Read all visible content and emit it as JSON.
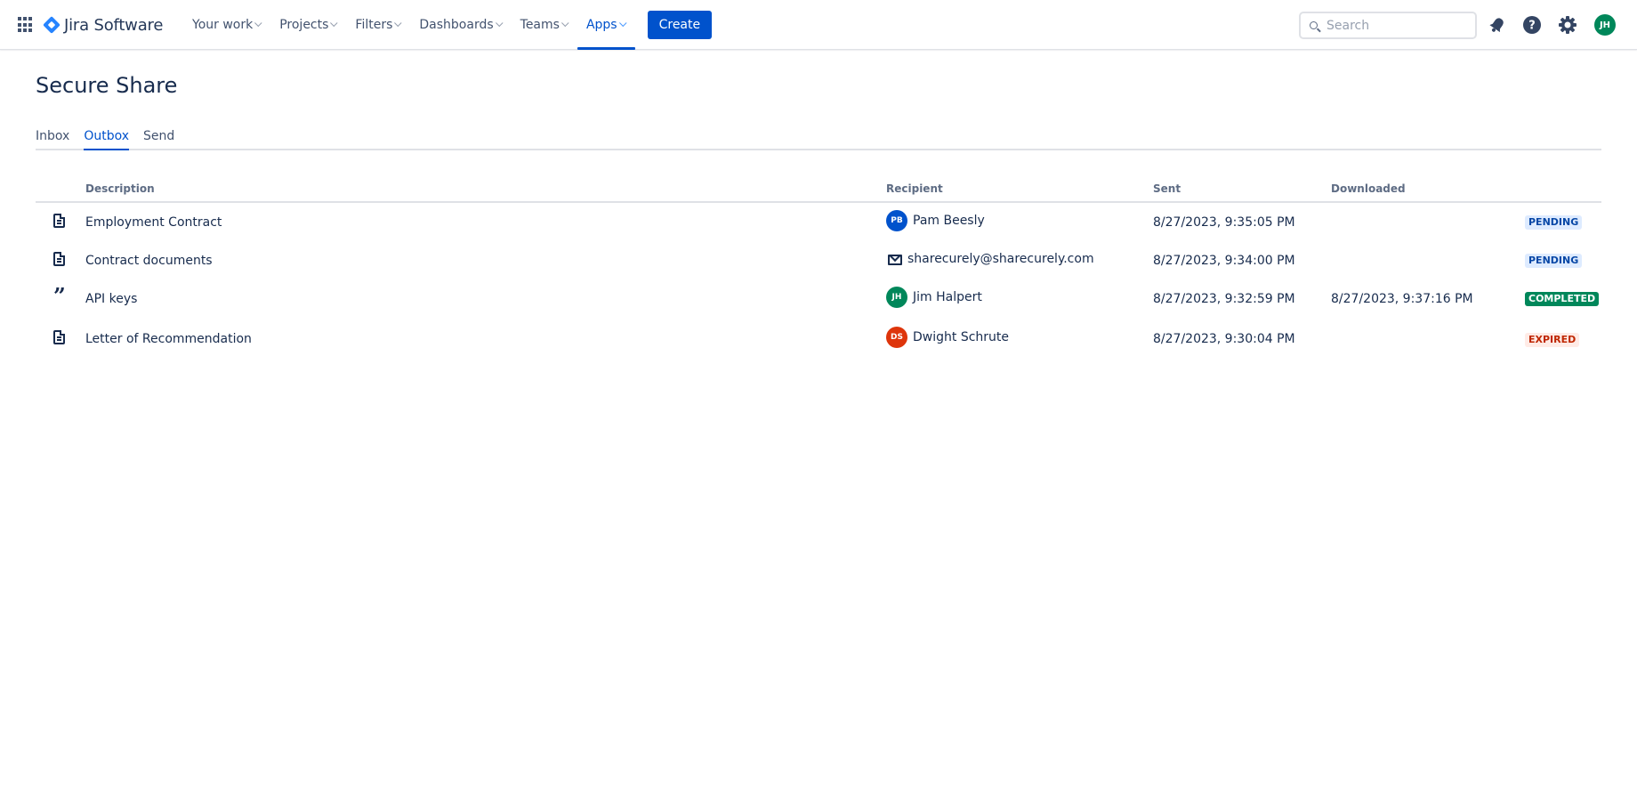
{
  "nav": {
    "product": "Jira Software",
    "items": [
      {
        "label": "Your work",
        "active": false
      },
      {
        "label": "Projects",
        "active": false
      },
      {
        "label": "Filters",
        "active": false
      },
      {
        "label": "Dashboards",
        "active": false
      },
      {
        "label": "Teams",
        "active": false
      },
      {
        "label": "Apps",
        "active": true
      }
    ],
    "create_label": "Create",
    "search_placeholder": "Search",
    "user_initials": "JH"
  },
  "page": {
    "title": "Secure Share",
    "tabs": [
      {
        "label": "Inbox",
        "active": false
      },
      {
        "label": "Outbox",
        "active": true
      },
      {
        "label": "Send",
        "active": false
      }
    ]
  },
  "table": {
    "headers": {
      "description": "Description",
      "recipient": "Recipient",
      "sent": "Sent",
      "downloaded": "Downloaded"
    },
    "rows": [
      {
        "icon": "document-icon",
        "description": "Employment Contract",
        "recipient_type": "user",
        "recipient_initials": "PB",
        "recipient_color": "#0052CC",
        "recipient": "Pam Beesly",
        "sent": "8/27/2023, 9:35:05 PM",
        "downloaded": "",
        "status": "PENDING",
        "status_bg": "#DEEBFF",
        "status_fg": "#0747A6"
      },
      {
        "icon": "document-icon",
        "description": "Contract documents",
        "recipient_type": "email",
        "recipient_initials": "",
        "recipient_color": "",
        "recipient": "sharecurely@sharecurely.com",
        "sent": "8/27/2023, 9:34:00 PM",
        "downloaded": "",
        "status": "PENDING",
        "status_bg": "#DEEBFF",
        "status_fg": "#0747A6"
      },
      {
        "icon": "quote-icon",
        "description": "API keys",
        "recipient_type": "user",
        "recipient_initials": "JH",
        "recipient_color": "#00875A",
        "recipient": "Jim Halpert",
        "sent": "8/27/2023, 9:32:59 PM",
        "downloaded": "8/27/2023, 9:37:16 PM",
        "status": "COMPLETED",
        "status_bg": "#00875A",
        "status_fg": "#FFFFFF"
      },
      {
        "icon": "document-icon",
        "description": "Letter of Recommendation",
        "recipient_type": "user",
        "recipient_initials": "DS",
        "recipient_color": "#DE350B",
        "recipient": "Dwight Schrute",
        "sent": "8/27/2023, 9:30:04 PM",
        "downloaded": "",
        "status": "EXPIRED",
        "status_bg": "#FFEBE6",
        "status_fg": "#BF2600"
      }
    ]
  }
}
